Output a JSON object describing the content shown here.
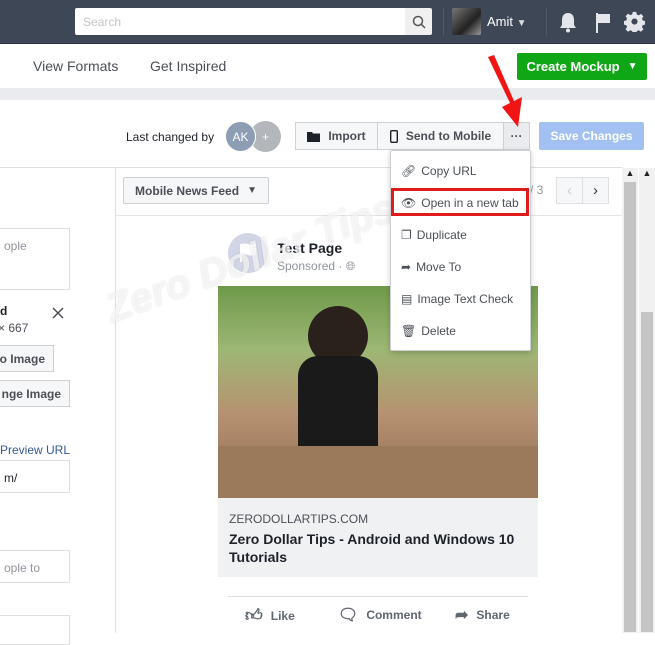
{
  "topbar": {
    "search_placeholder": "Search",
    "user_name": "Amit"
  },
  "nav": {
    "view_formats": "View Formats",
    "get_inspired": "Get Inspired",
    "create_mockup": "Create Mockup"
  },
  "toolbar": {
    "last_changed_by": "Last changed by",
    "avatar_initials": "AK",
    "add_label": "+",
    "import": "Import",
    "send_to_mobile": "Send to Mobile",
    "more": "···",
    "save_changes": "Save Changes"
  },
  "menu": {
    "items": [
      {
        "label": "Copy URL",
        "icon": "link-icon"
      },
      {
        "label": "Open in a new tab",
        "icon": "eye-icon"
      },
      {
        "label": "Duplicate",
        "icon": "duplicate-icon"
      },
      {
        "label": "Move To",
        "icon": "share-arrow-icon"
      },
      {
        "label": "Image Text Check",
        "icon": "image-check-icon"
      },
      {
        "label": "Delete",
        "icon": "trash-icon"
      }
    ],
    "highlighted": "Open in a new tab"
  },
  "left": {
    "field1": "ople",
    "image_name": "d",
    "image_size": "× 667",
    "btn1": "o Image",
    "btn2": "nge Image",
    "preview_url": "Preview URL",
    "url_value": "m/",
    "field2": "ople to"
  },
  "preview": {
    "placement": "Mobile News Feed",
    "page_count": "/ 3"
  },
  "post": {
    "page_name": "Test Page",
    "sponsored": "Sponsored ·",
    "domain": "ZERODOLLARTIPS.COM",
    "headline": "Zero Dollar Tips - Android and Windows 10 Tutorials",
    "like": "Like",
    "comment": "Comment",
    "share": "Share"
  },
  "watermark": "Zero Dollar Tips",
  "colors": {
    "topbar": "#3d4756",
    "create": "#10a716",
    "save": "#a3c0f3",
    "highlight": "#e01b1b",
    "link": "#365899"
  }
}
